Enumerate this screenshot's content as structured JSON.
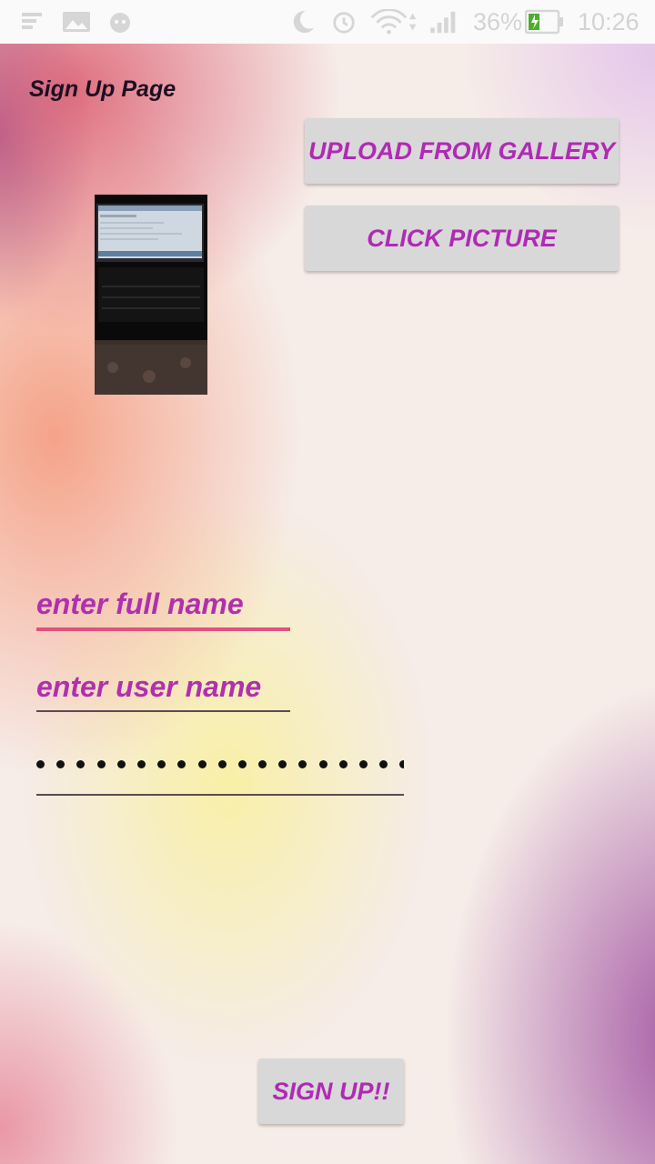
{
  "status_bar": {
    "battery_percent": "36%",
    "time": "10:26",
    "icons": [
      "notification-icon",
      "image-icon",
      "android-icon",
      "moon-icon",
      "alarm-icon",
      "wifi-icon",
      "signal-icon",
      "battery-icon"
    ]
  },
  "page": {
    "title": "Sign Up Page"
  },
  "buttons": {
    "upload": "UPLOAD FROM GALLERY",
    "click_picture": "CLICK PICTURE",
    "sign_up": "SIGN UP!!"
  },
  "form": {
    "full_name_placeholder": "enter full name",
    "user_name_placeholder": "enter user name",
    "password_mask_length": 19
  },
  "colors": {
    "accent": "#b02ab4",
    "focused_underline": "#e0527f",
    "button_bg": "#d8d8d8"
  }
}
